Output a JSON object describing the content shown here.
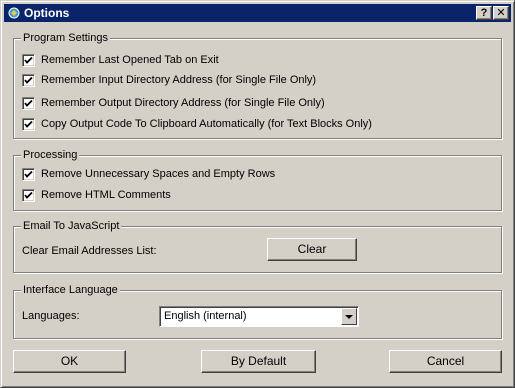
{
  "window": {
    "title": "Options",
    "help_label": "?",
    "close_label": "✕"
  },
  "program_settings": {
    "title": "Program Settings",
    "items": [
      {
        "label": "Remember Last Opened Tab on Exit",
        "checked": true
      },
      {
        "label": "Remember Input Directory Address (for Single File Only)",
        "checked": true
      },
      {
        "label": "Remember Output Directory Address (for Single File Only)",
        "checked": true
      },
      {
        "label": "Copy Output Code To Clipboard Automatically (for Text Blocks Only)",
        "checked": true
      }
    ]
  },
  "processing": {
    "title": "Processing",
    "items": [
      {
        "label": "Remove Unnecessary Spaces and Empty Rows",
        "checked": true
      },
      {
        "label": "Remove HTML Comments",
        "checked": true
      }
    ]
  },
  "email_to_js": {
    "title": "Email To JavaScript",
    "clear_list_label": "Clear Email Addresses List:",
    "clear_button": "Clear"
  },
  "interface_language": {
    "title": "Interface Language",
    "languages_label": "Languages:",
    "selected_language": "English (internal)"
  },
  "footer": {
    "ok": "OK",
    "by_default": "By Default",
    "cancel": "Cancel"
  },
  "colors": {
    "titlebar": "#0a246a",
    "face": "#d4d0c8"
  }
}
